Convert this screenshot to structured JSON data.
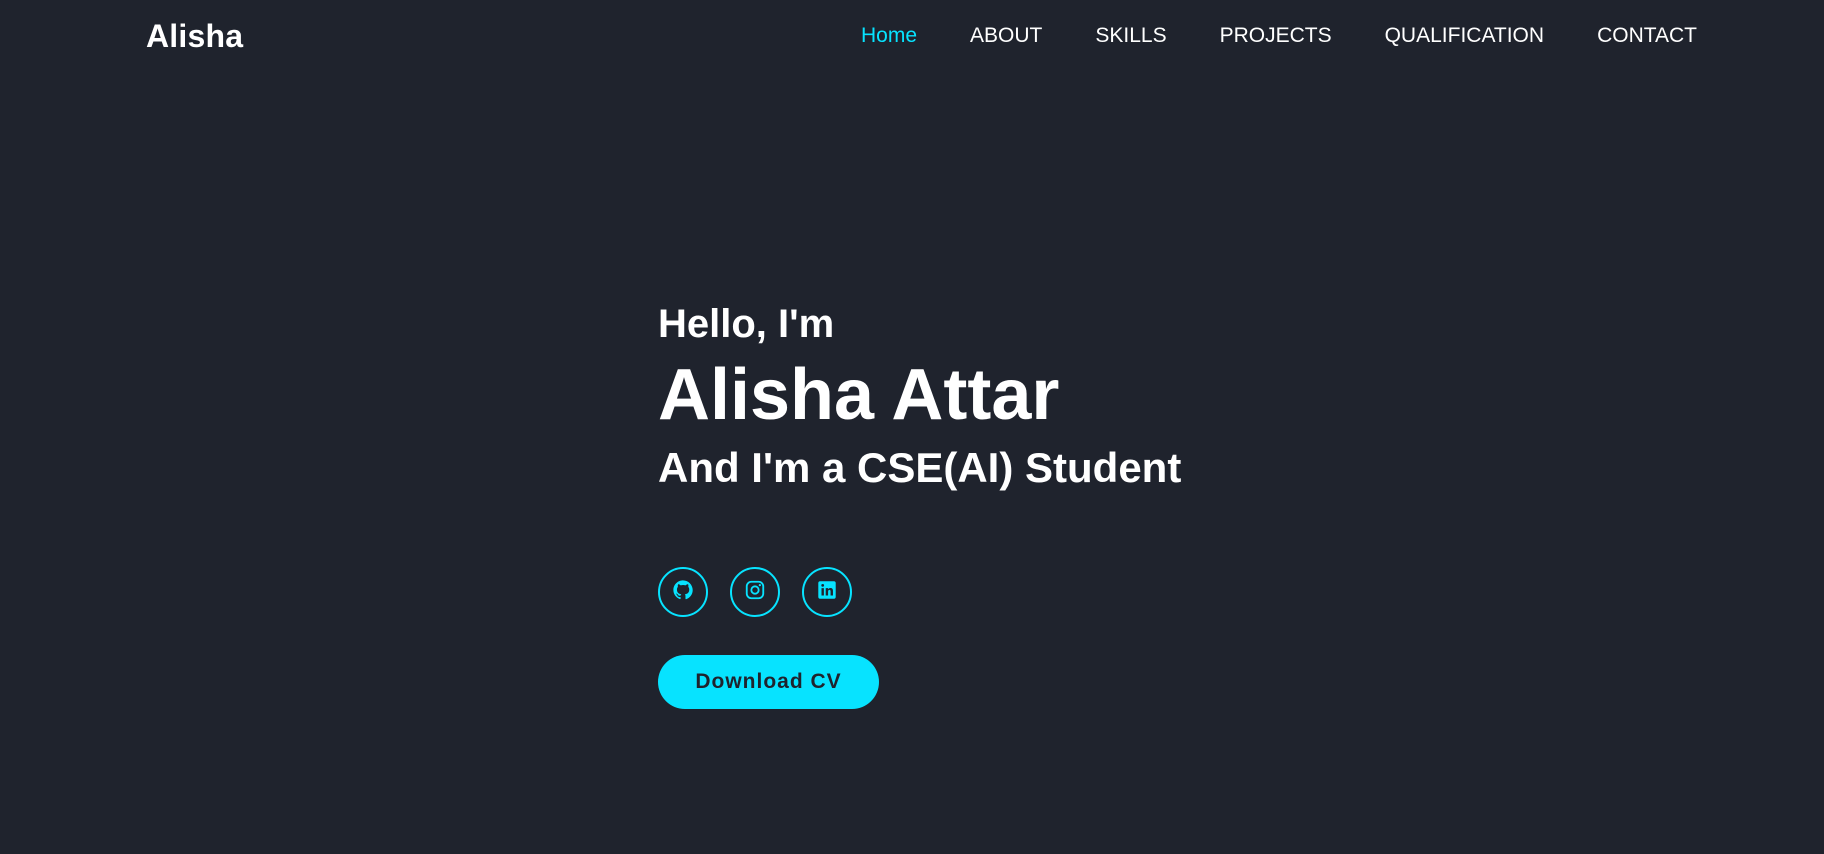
{
  "header": {
    "logo": "Alisha",
    "nav": [
      {
        "label": "Home",
        "active": true
      },
      {
        "label": "ABOUT"
      },
      {
        "label": "SKILLS"
      },
      {
        "label": "PROJECTS"
      },
      {
        "label": "QUALIFICATION"
      },
      {
        "label": "CONTACT"
      }
    ]
  },
  "hero": {
    "greeting": "Hello, I'm",
    "name": "Alisha Attar",
    "tagline": "And I'm a CSE(AI) Student",
    "socials": [
      {
        "icon": "github-icon"
      },
      {
        "icon": "instagram-icon"
      },
      {
        "icon": "linkedin-icon"
      }
    ],
    "cta_label": "Download CV"
  },
  "colors": {
    "background": "#1f232d",
    "accent": "#07e3ff",
    "text": "#ffffff"
  }
}
